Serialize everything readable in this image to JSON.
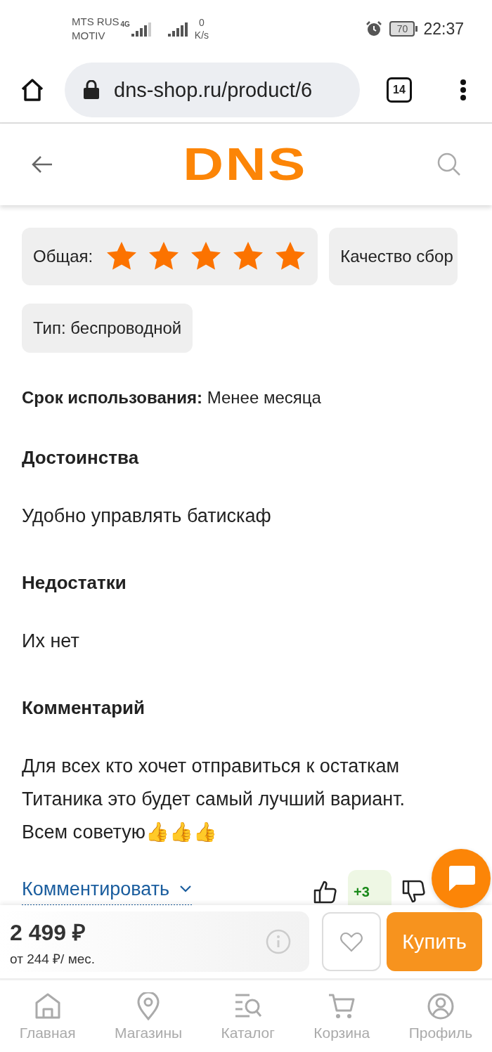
{
  "status_bar": {
    "carrier_1": "MTS RUS",
    "carrier_2": "MOTIV",
    "network": "4G",
    "speed_value": "0",
    "speed_unit": "K/s",
    "battery": "70",
    "time": "22:37"
  },
  "browser": {
    "url": "dns-shop.ru/product/6",
    "tab_count": "14"
  },
  "header": {
    "logo": "DNS"
  },
  "ratings": [
    {
      "label": "Общая:",
      "stars": 5
    },
    {
      "label": "Качество сбор"
    }
  ],
  "properties": [
    {
      "label": "Тип: беспроводной"
    }
  ],
  "usage": {
    "label": "Срок использования:",
    "value": "Менее месяца"
  },
  "sections": [
    {
      "title": "Достоинства",
      "text": "Удобно управлять батискаф"
    },
    {
      "title": "Недостатки",
      "text": "Их нет"
    },
    {
      "title": "Комментарий",
      "text": "Для всех кто хочет отправиться к остаткам Титаника это будет самый лучший вариант. Всем советую👍👍👍"
    }
  ],
  "comment_link": "Комментировать",
  "votes": {
    "score": "+3"
  },
  "price_bar": {
    "price": "2 499 ₽",
    "installment": "от 244 ₽/ мес.",
    "buy": "Купить"
  },
  "nav": [
    {
      "label": "Главная"
    },
    {
      "label": "Магазины"
    },
    {
      "label": "Каталог"
    },
    {
      "label": "Корзина"
    },
    {
      "label": "Профиль"
    }
  ]
}
